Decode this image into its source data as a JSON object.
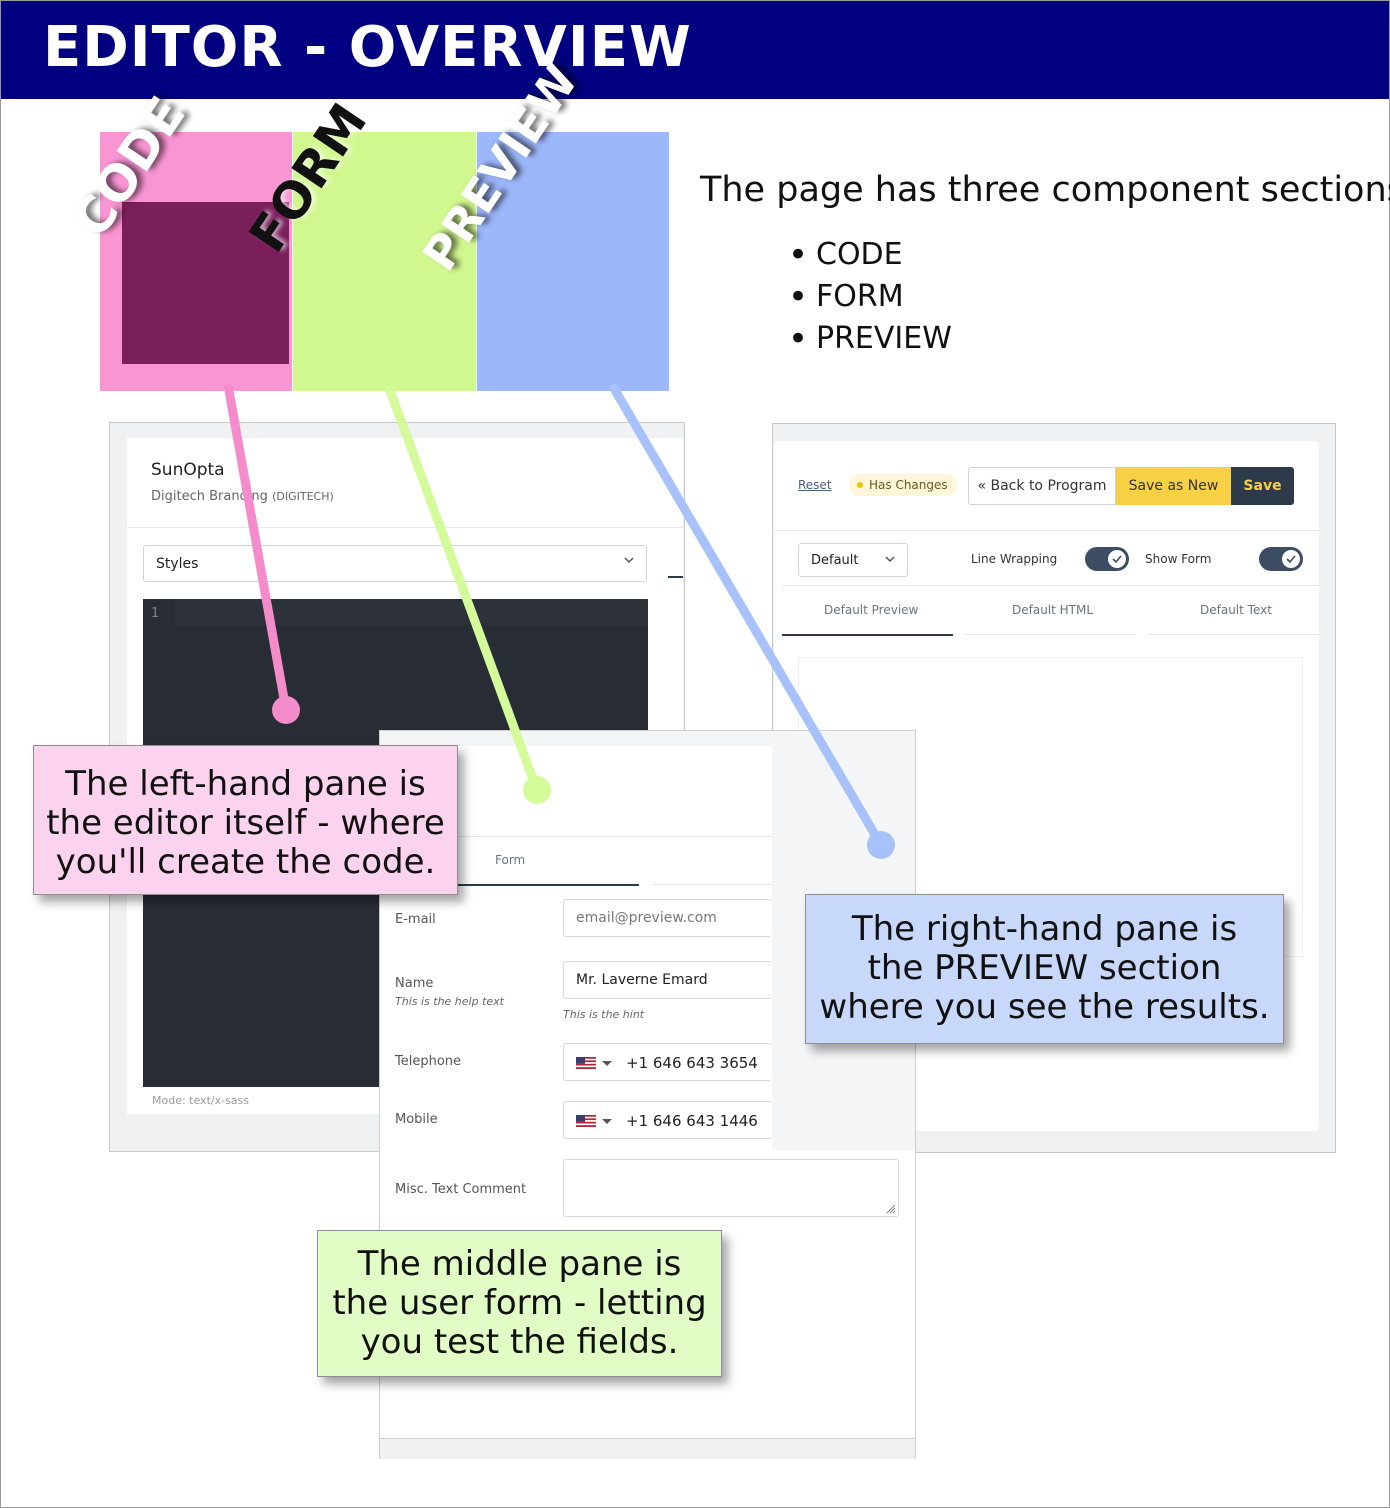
{
  "header": {
    "title": "EDITOR - OVERVIEW"
  },
  "thumbnail": {
    "labels": {
      "code": "CODE",
      "form": "FORM",
      "preview": "PREVIEW"
    },
    "colors": {
      "code": "#fa78c8",
      "form": "#c8f878",
      "preview": "#8caafa"
    }
  },
  "intro": {
    "text": "The page has three component sections:",
    "sections": [
      "CODE",
      "FORM",
      "PREVIEW"
    ]
  },
  "left_pane": {
    "brand_name": "SunOpta",
    "brand_sub": "Digitech Branding",
    "brand_code": "(DIGITECH)",
    "styles_select": "Styles",
    "line_number": "1",
    "mode": "Mode: text/x-sass"
  },
  "form_pane": {
    "tab": "Form",
    "email": {
      "label": "E-mail",
      "placeholder": "email@preview.com"
    },
    "name": {
      "label": "Name",
      "help": "This is the help text",
      "value": "Mr. Laverne Emard",
      "hint": "This is the hint"
    },
    "telephone": {
      "label": "Telephone",
      "value": "+1 646 643 3654"
    },
    "mobile": {
      "label": "Mobile",
      "value": "+1 646 643 1446"
    },
    "misc": {
      "label": "Misc. Text Comment"
    }
  },
  "preview_pane": {
    "reset": "Reset",
    "has_changes": "Has Changes",
    "back": "« Back to Program",
    "save_as_new": "Save as New",
    "save": "Save",
    "default_select": "Default",
    "line_wrapping": "Line Wrapping",
    "show_form": "Show Form",
    "tabs": [
      "Default Preview",
      "Default HTML",
      "Default Text"
    ],
    "colors": {
      "accent_dark": "#2d3a4a",
      "accent_yellow": "#f7d046"
    }
  },
  "callouts": {
    "code": [
      "The left-hand pane is",
      "the editor itself - where",
      "you'll create the code."
    ],
    "form": [
      "The middle pane is",
      "the user form - letting",
      "you test the fields."
    ],
    "preview": [
      "The right-hand pane is",
      "the PREVIEW section",
      "where you see the results."
    ]
  }
}
